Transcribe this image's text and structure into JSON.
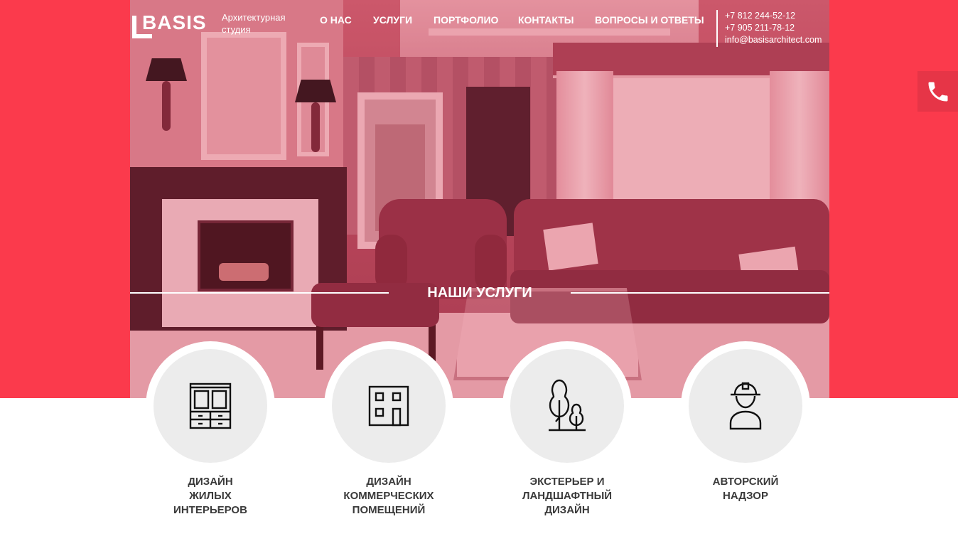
{
  "brand": {
    "logo_text": "BASIS",
    "tagline": "Архитектурная студия",
    "accent_color": "#fb3a4c"
  },
  "nav": {
    "items": [
      {
        "label": "О НАС"
      },
      {
        "label": "УСЛУГИ"
      },
      {
        "label": "ПОРТФОЛИО"
      },
      {
        "label": "КОНТАКТЫ"
      },
      {
        "label": "ВОПРОСЫ И ОТВЕТЫ"
      }
    ]
  },
  "contacts": {
    "phone1": "+7 812 244-52-12",
    "phone2": "+7 905 211-78-12",
    "email": "info@basisarchitect.com"
  },
  "call_button": {
    "icon": "phone-icon"
  },
  "services_section": {
    "title": "НАШИ УСЛУГИ",
    "items": [
      {
        "label": "ДИЗАЙН\nЖИЛЫХ\nИНТЕРЬЕРОВ",
        "icon": "wardrobe-icon"
      },
      {
        "label": "ДИЗАЙН\nКОММЕРЧЕСКИХ\nПОМЕЩЕНИЙ",
        "icon": "building-icon"
      },
      {
        "label": "ЭКСТЕРЬЕР И\nЛАНДШАФТНЫЙ\nДИЗАЙН",
        "icon": "trees-icon"
      },
      {
        "label": "АВТОРСКИЙ\nНАДЗОР",
        "icon": "worker-icon"
      }
    ]
  }
}
